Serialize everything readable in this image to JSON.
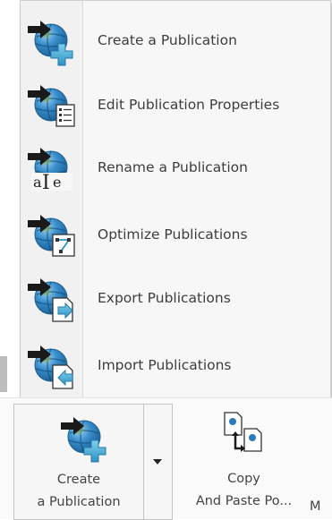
{
  "menu": {
    "items": [
      {
        "label": "Create a Publication",
        "icon": "create-publication-icon"
      },
      {
        "label": "Edit Publication Properties",
        "icon": "edit-properties-icon"
      },
      {
        "label": "Rename a Publication",
        "icon": "rename-icon"
      },
      {
        "label": "Optimize Publications",
        "icon": "optimize-icon"
      },
      {
        "label": "Export Publications",
        "icon": "export-icon"
      },
      {
        "label": "Import Publications",
        "icon": "import-icon"
      }
    ]
  },
  "ribbon": {
    "create_line1": "Create",
    "create_line2": "a Publication",
    "copy_line1": "Copy",
    "copy_line2": "And Paste Po...",
    "overflow_letter": "M"
  },
  "colors": {
    "globe_blue": "#2a7bb8",
    "badge_cyan": "#4fb3d9",
    "arrow_dark": "#1a1a1a",
    "menu_bg": "#f7f7f7"
  }
}
